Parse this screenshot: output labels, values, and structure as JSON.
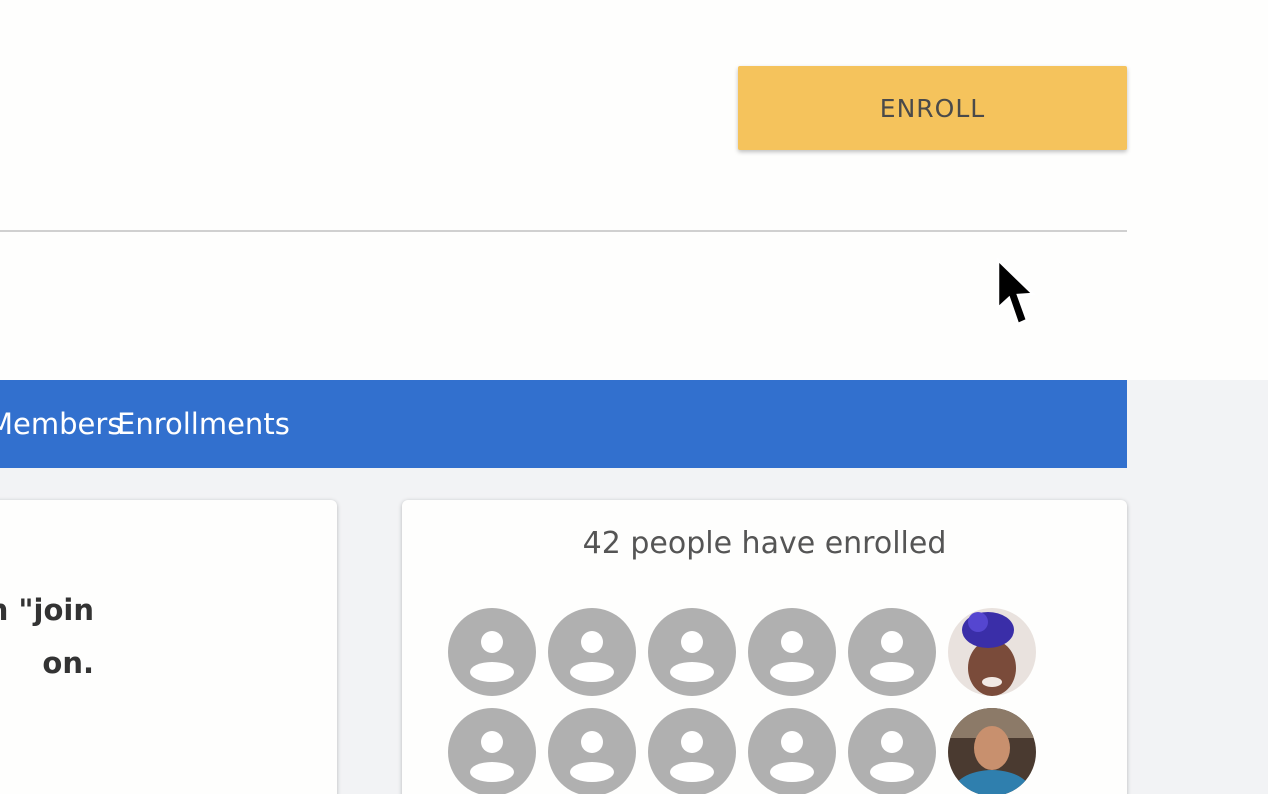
{
  "header": {
    "enroll_label": "ENROLL"
  },
  "tabs": {
    "members_label": "Members",
    "enrollments_label": "Enrollments"
  },
  "description": {
    "line1": "n \"join",
    "line2": "on."
  },
  "enrollments": {
    "count_text": "42 people have enrolled"
  },
  "colors": {
    "enroll_button": "#f5c35c",
    "tab_bar": "#3270ce",
    "placeholder_avatar": "#b0b0b0",
    "background": "#f2f3f5"
  },
  "icons": {
    "cursor": "mouse-pointer-icon",
    "placeholder": "default-avatar-icon"
  }
}
